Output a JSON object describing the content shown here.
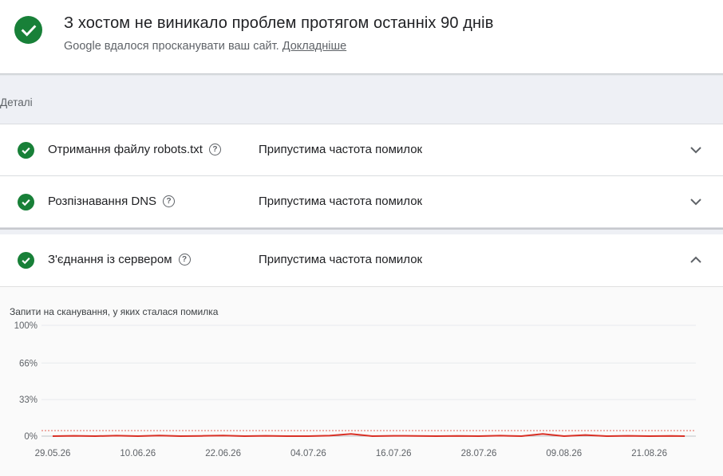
{
  "header": {
    "title": "З хостом не виникало проблем протягом останніх 90 днів",
    "subtitle": "Google вдалося просканувати ваш сайт.",
    "link": "Докладніше",
    "icon": "check-circle-icon",
    "status_color": "#188038"
  },
  "details_label": "Деталі",
  "rows": [
    {
      "name": "Отримання файлу robots.txt",
      "status": "Припустима частота помилок",
      "expanded": false
    },
    {
      "name": "Розпізнавання DNS",
      "status": "Припустима частота помилок",
      "expanded": false
    },
    {
      "name": "З'єднання із сервером",
      "status": "Припустима частота помилок",
      "expanded": true
    }
  ],
  "chart_data": {
    "type": "line",
    "title": "Запити на сканування, у яких сталася помилка",
    "y_ticks": [
      "100%",
      "66%",
      "33%",
      "0%"
    ],
    "y_tick_values": [
      100,
      66,
      33,
      0
    ],
    "ylim": [
      0,
      100
    ],
    "x_ticks": [
      "29.05.26",
      "10.06.26",
      "22.06.26",
      "04.07.26",
      "16.07.26",
      "28.07.26",
      "09.08.26",
      "21.08.26"
    ],
    "threshold": 5,
    "series": [
      {
        "color": "#d93025",
        "x": [
          "29.05.26",
          "01.06.26",
          "04.06.26",
          "07.06.26",
          "10.06.26",
          "13.06.26",
          "16.06.26",
          "19.06.26",
          "22.06.26",
          "25.06.26",
          "28.06.26",
          "01.07.26",
          "04.07.26",
          "07.07.26",
          "10.07.26",
          "13.07.26",
          "16.07.26",
          "19.07.26",
          "22.07.26",
          "25.07.26",
          "28.07.26",
          "31.07.26",
          "03.08.26",
          "06.08.26",
          "09.08.26",
          "12.08.26",
          "15.08.26",
          "18.08.26",
          "21.08.26",
          "24.08.26",
          "26.08.26"
        ],
        "values": [
          0,
          0.3,
          0,
          0.4,
          0,
          0.5,
          0,
          0.2,
          0.6,
          0,
          0.3,
          0,
          0,
          0.4,
          2,
          0,
          0.3,
          0.2,
          0,
          0.2,
          0,
          0.4,
          0,
          2,
          0,
          1,
          0,
          0.3,
          0,
          0.2,
          0
        ]
      }
    ],
    "grid": true
  }
}
